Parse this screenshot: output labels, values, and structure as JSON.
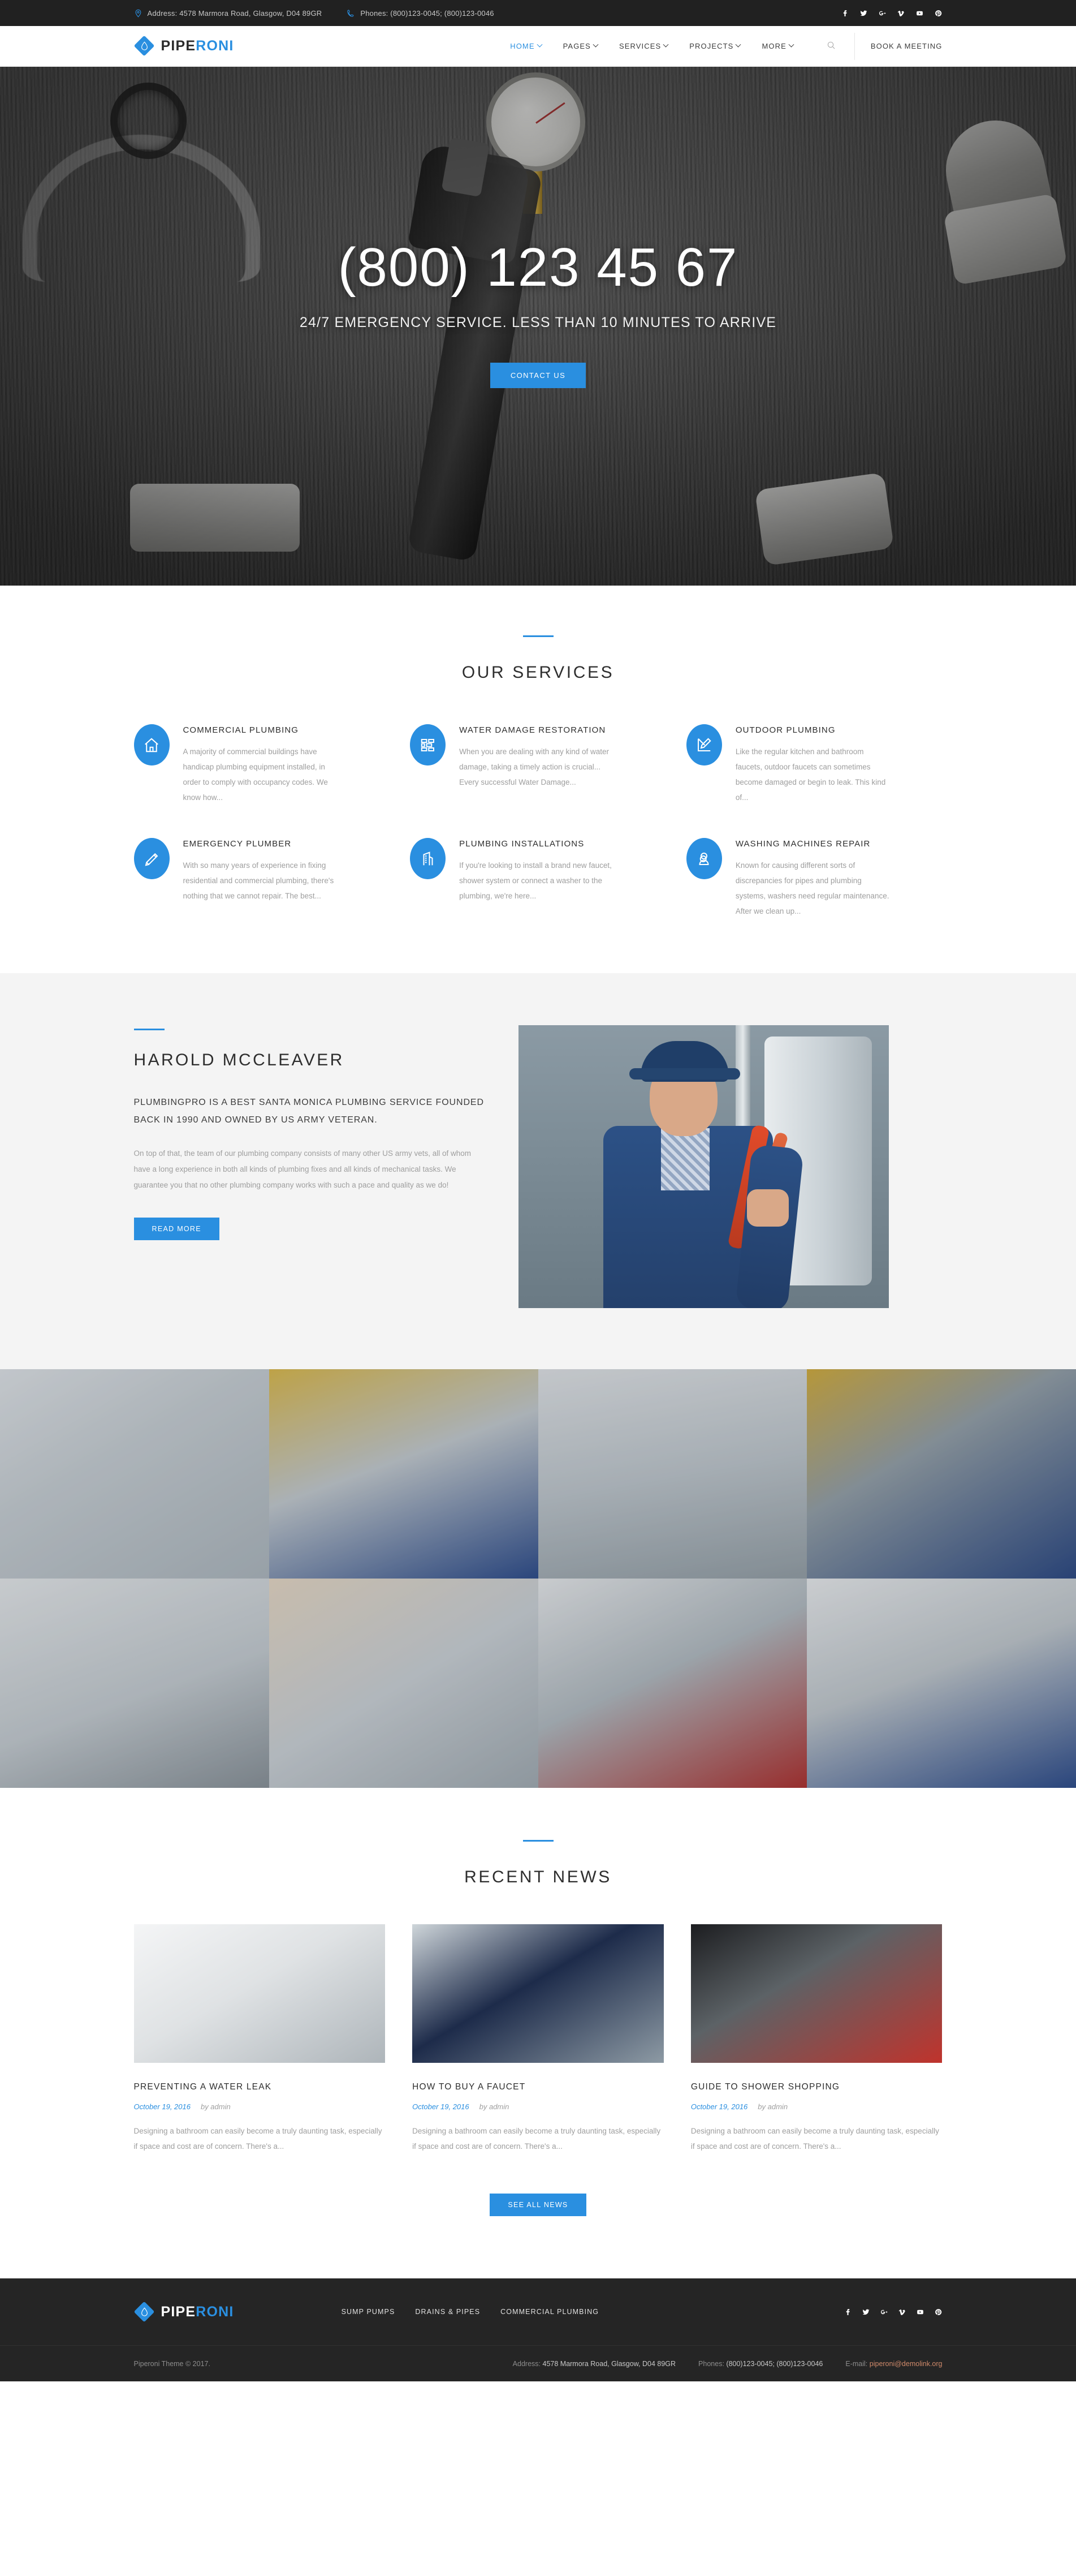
{
  "colors": {
    "accent": "#2a8fe0",
    "dark": "#212121",
    "footer": "#252525",
    "muted": "#9e9e9e"
  },
  "topbar": {
    "address": "Address: 4578 Marmora Road, Glasgow, D04 89GR",
    "phones": "Phones: (800)123-0045; (800)123-0046",
    "social": [
      "facebook",
      "twitter",
      "google-plus",
      "vimeo",
      "youtube",
      "pinterest"
    ]
  },
  "header": {
    "logo_first": "PIPE",
    "logo_second": "RONI",
    "nav": [
      {
        "label": "HOME",
        "has_dropdown": true,
        "active": true
      },
      {
        "label": "PAGES",
        "has_dropdown": true,
        "active": false
      },
      {
        "label": "SERVICES",
        "has_dropdown": true,
        "active": false
      },
      {
        "label": "PROJECTS",
        "has_dropdown": true,
        "active": false
      },
      {
        "label": "MORE",
        "has_dropdown": true,
        "active": false
      }
    ],
    "search_label": "search-icon",
    "book_label": "BOOK A MEETING"
  },
  "hero": {
    "phone": "(800) 123 45 67",
    "subtitle": "24/7 EMERGENCY SERVICE. LESS THAN 10 MINUTES TO ARRIVE",
    "cta": "CONTACT US"
  },
  "services": {
    "title": "OUR SERVICES",
    "items": [
      {
        "icon": "house-icon",
        "title": "COMMERCIAL PLUMBING",
        "text": "A majority of commercial buildings have handicap plumbing equipment installed, in order to comply with occupancy codes. We know how..."
      },
      {
        "icon": "brick-wall-icon",
        "title": "WATER DAMAGE RESTORATION",
        "text": "When you are dealing with any kind of water damage, taking a timely action is crucial... Every successful Water Damage..."
      },
      {
        "icon": "ruler-pencil-icon",
        "title": "OUTDOOR PLUMBING",
        "text": "Like the regular kitchen and bathroom faucets, outdoor faucets can sometimes become damaged or begin to leak. This kind of..."
      },
      {
        "icon": "pencil-icon",
        "title": "EMERGENCY PLUMBER",
        "text": "With so many years of experience in fixing residential and commercial plumbing, there's nothing that we cannot repair. The best..."
      },
      {
        "icon": "building-icon",
        "title": "PLUMBING INSTALLATIONS",
        "text": "If you're looking to install a brand new faucet, shower system or connect a washer to the plumbing, we're here..."
      },
      {
        "icon": "washing-machine-icon",
        "title": "WASHING MACHINES REPAIR",
        "text": "Known for causing different sorts of discrepancies for pipes and plumbing systems, washers need regular maintenance. After we clean up..."
      }
    ]
  },
  "about": {
    "name": "HAROLD MCCLEAVER",
    "lead": "PLUMBINGPRO IS A BEST SANTA MONICA PLUMBING SERVICE FOUNDED BACK IN 1990 AND OWNED BY US ARMY VETERAN.",
    "body": "On top of that, the team of our plumbing company consists of many other US army vets, all of whom have a long experience in both all kinds of plumbing fixes and all kinds of mechanical tasks. We guarantee you that no other plumbing company works with such a pace and quality as we do!",
    "cta": "READ MORE",
    "photo_alt": "plumber-holding-red-pipe-wrench"
  },
  "gallery": {
    "items": [
      "plumber-hand-fitting-pipe-valve",
      "two-plumbers-in-hard-hats-with-hose",
      "wall-mounted-chrome-faucet",
      "plumber-in-hard-hat-working-on-boiler",
      "hand-with-wrench-on-bathroom-tap",
      "hands-fixing-sink-drain-trap",
      "smiling-plumber-in-red-cap-under-sink",
      "plumber-with-toolbox-under-sink"
    ]
  },
  "news": {
    "title": "RECENT NEWS",
    "cta": "SEE ALL NEWS",
    "posts": [
      {
        "thumb": "blueprint-and-adjustable-wrench",
        "title": "PREVENTING A WATER LEAK",
        "date": "October 19, 2016",
        "author": "by admin",
        "excerpt": "Designing a bathroom can easily become a truly daunting task, especially if space and cost are of concern. There's a..."
      },
      {
        "thumb": "plumber-inspecting-pipes",
        "title": "HOW TO BUY A FAUCET",
        "date": "October 19, 2016",
        "author": "by admin",
        "excerpt": "Designing a bathroom can easily become a truly daunting task, especially if space and cost are of concern. There's a..."
      },
      {
        "thumb": "red-fire-hydrant-spraying-water",
        "title": "GUIDE TO SHOWER SHOPPING",
        "date": "October 19, 2016",
        "author": "by admin",
        "excerpt": "Designing a bathroom can easily become a truly daunting task, especially if space and cost are of concern. There's a..."
      }
    ]
  },
  "footer": {
    "logo_first": "PIPE",
    "logo_second": "RONI",
    "nav": [
      "SUMP PUMPS",
      "DRAINS & PIPES",
      "COMMERCIAL PLUMBING"
    ],
    "social": [
      "facebook",
      "twitter",
      "google-plus",
      "vimeo",
      "youtube",
      "pinterest"
    ],
    "copyright": "Piperoni Theme © 2017.",
    "address_label": "Address:",
    "address_value": "4578 Marmora Road, Glasgow, D04 89GR",
    "phones_label": "Phones:",
    "phones_value": "(800)123-0045; (800)123-0046",
    "email_label": "E-mail:",
    "email_value": "piperoni@demolink.org"
  }
}
